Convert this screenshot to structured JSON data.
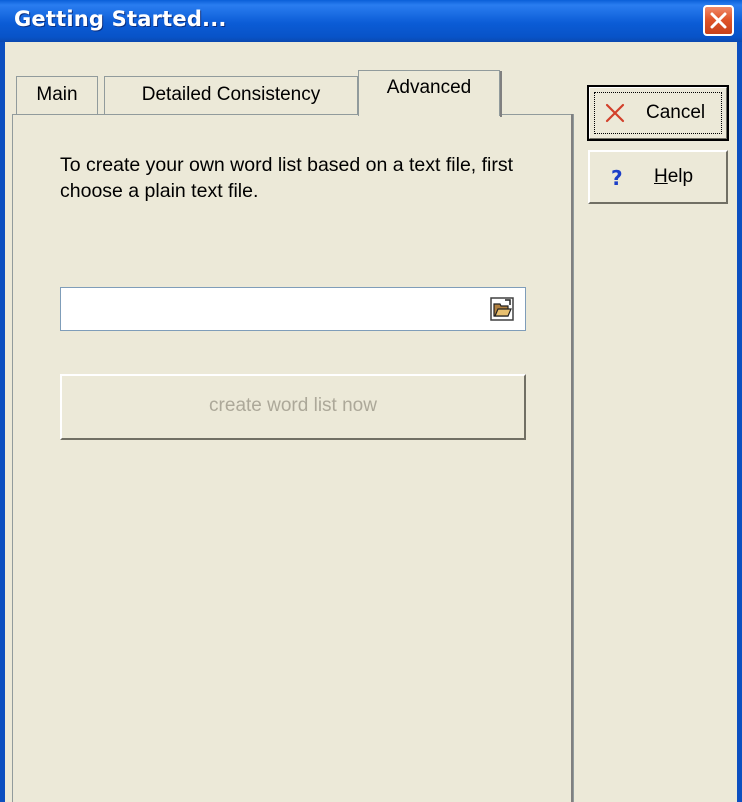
{
  "window": {
    "title": "Getting Started...",
    "close_icon": "close-icon"
  },
  "tabs": [
    {
      "label": "Main",
      "active": false
    },
    {
      "label": "Detailed Consistency",
      "active": false
    },
    {
      "label": "Advanced",
      "active": true
    }
  ],
  "advanced_tab": {
    "instructions": "To create your own word list based on a text file, first choose a plain text file.",
    "file_path": {
      "value": "",
      "placeholder": ""
    },
    "browse_icon": "folder-open-icon",
    "create_button_label": "create word list now",
    "create_button_enabled": false
  },
  "side_buttons": {
    "cancel_label": "Cancel",
    "cancel_icon": "cancel-x-icon",
    "help_label": "Help",
    "help_icon": "question-mark-icon"
  },
  "colors": {
    "titlebar": "#0A5FD8",
    "dialog_bg": "#ECE9D8",
    "close_button": "#E0552A",
    "cancel_x": "#D2402A",
    "help_question": "#1C3FC8",
    "disabled_text": "#ACA899"
  }
}
